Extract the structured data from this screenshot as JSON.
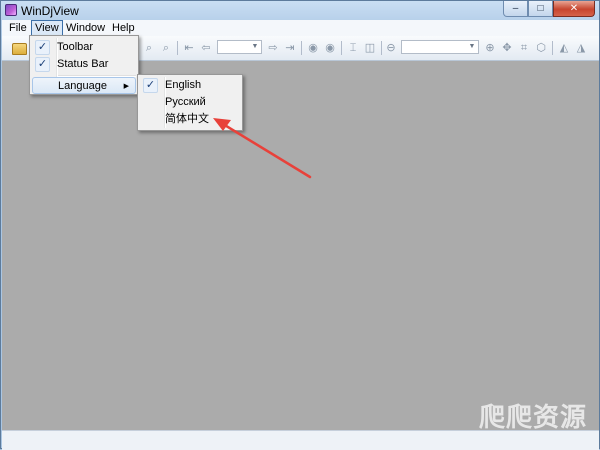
{
  "window": {
    "title": "WinDjView"
  },
  "caption": {
    "minimize": "‒",
    "maximize": "□",
    "close": "✕"
  },
  "menubar": {
    "file": "File",
    "view": "View",
    "window": "Window",
    "help": "Help"
  },
  "view_menu": {
    "items": [
      {
        "label": "Toolbar",
        "checked": true
      },
      {
        "label": "Status Bar",
        "checked": true
      },
      {
        "label": "Language",
        "submenu": true
      }
    ]
  },
  "language_menu": {
    "items": [
      {
        "label": "English",
        "checked": true
      },
      {
        "label": "Русский"
      },
      {
        "label": "简体中文"
      }
    ]
  },
  "annotation": {
    "color": "#e8413a"
  },
  "watermark": {
    "text": "爬爬资源"
  },
  "icons": [
    "open-folder-icon",
    "zoom-in-icon",
    "zoom-out-icon",
    "first-page-icon",
    "prev-page-icon",
    "next-page-icon",
    "last-page-icon",
    "back-icon",
    "forward-icon",
    "fit-page-icon",
    "two-pages-icon",
    "zoom-out-circle-icon",
    "zoom-in-circle-icon",
    "rotate-icon",
    "fit-width-icon",
    "rotate-left-icon",
    "rotate-right-icon"
  ]
}
